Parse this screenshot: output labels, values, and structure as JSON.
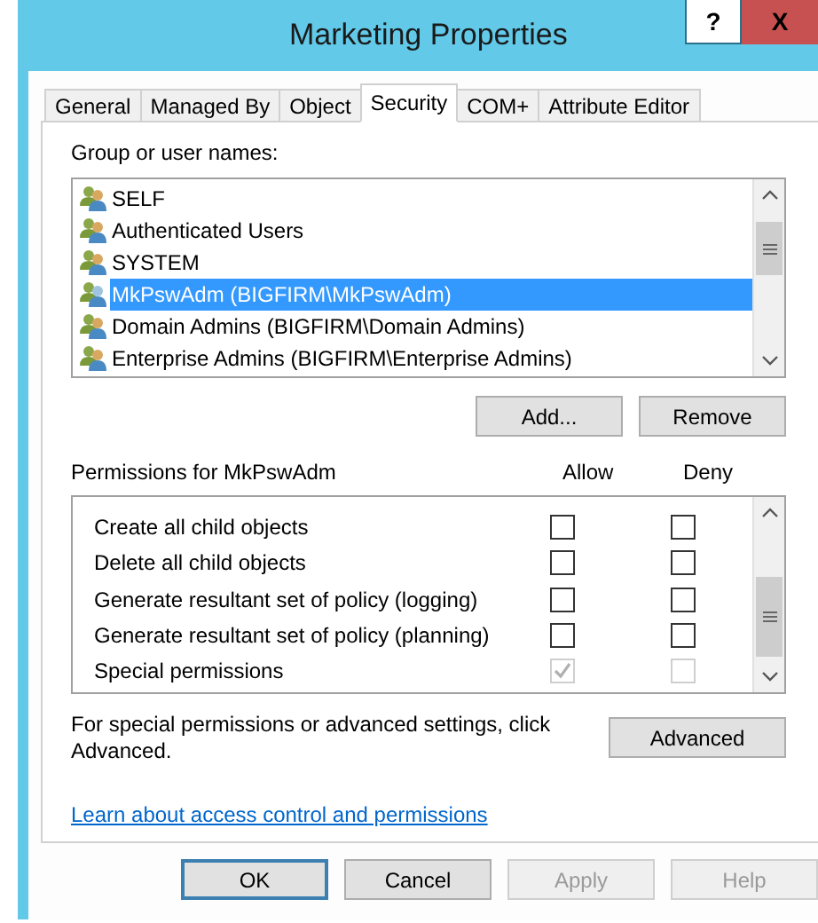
{
  "window": {
    "title": "Marketing Properties",
    "help": "?",
    "close": "X"
  },
  "tabs": [
    {
      "label": "General",
      "selected": false
    },
    {
      "label": "Managed By",
      "selected": false
    },
    {
      "label": "Object",
      "selected": false
    },
    {
      "label": "Security",
      "selected": true
    },
    {
      "label": "COM+",
      "selected": false
    },
    {
      "label": "Attribute Editor",
      "selected": false
    }
  ],
  "users": {
    "label": "Group or user names:",
    "items": [
      {
        "name": "SELF",
        "selected": false
      },
      {
        "name": "Authenticated Users",
        "selected": false
      },
      {
        "name": "SYSTEM",
        "selected": false
      },
      {
        "name": "MkPswAdm (BIGFIRM\\MkPswAdm)",
        "selected": true
      },
      {
        "name": "Domain Admins (BIGFIRM\\Domain Admins)",
        "selected": false
      },
      {
        "name": "Enterprise Admins (BIGFIRM\\Enterprise Admins)",
        "selected": false
      }
    ]
  },
  "user_buttons": [
    {
      "label": "Add...",
      "disabled": false
    },
    {
      "label": "Remove",
      "disabled": false
    }
  ],
  "permissions": {
    "label": "Permissions for MkPswAdm",
    "allow_header": "Allow",
    "deny_header": "Deny",
    "rows": [
      {
        "name": "Create all child objects",
        "allow": false,
        "deny": false,
        "disabled": false
      },
      {
        "name": "Delete all child objects",
        "allow": false,
        "deny": false,
        "disabled": false
      },
      {
        "name": "Generate resultant set of policy (logging)",
        "allow": false,
        "deny": false,
        "disabled": false
      },
      {
        "name": "Generate resultant set of policy (planning)",
        "allow": false,
        "deny": false,
        "disabled": false
      },
      {
        "name": "Special permissions",
        "allow": true,
        "deny": false,
        "disabled": true
      }
    ]
  },
  "advanced": {
    "text": "For special permissions or advanced settings, click Advanced.",
    "button": "Advanced"
  },
  "link": "Learn about access control and permissions",
  "buttons": [
    {
      "label": "OK",
      "disabled": false,
      "default": true
    },
    {
      "label": "Cancel",
      "disabled": false,
      "default": false
    },
    {
      "label": "Apply",
      "disabled": true,
      "default": false
    },
    {
      "label": "Help",
      "disabled": true,
      "default": false
    }
  ]
}
